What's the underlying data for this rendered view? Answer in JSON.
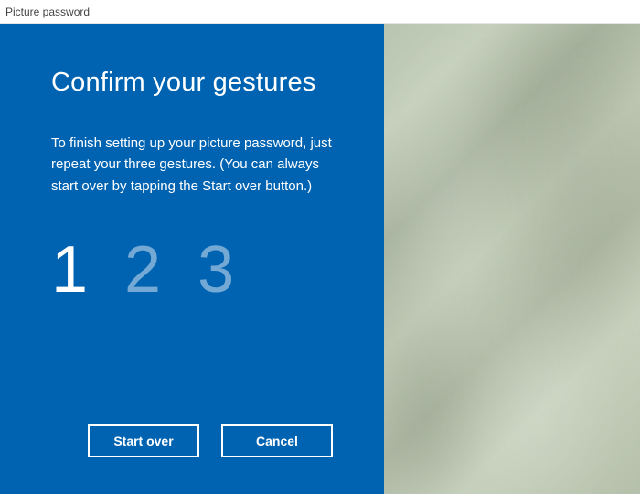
{
  "window": {
    "title": "Picture password"
  },
  "panel": {
    "heading": "Confirm your gestures",
    "instruction": "To finish setting up your picture password, just repeat your three gestures. (You can always start over by tapping the Start over button.)",
    "steps": {
      "s1": "1",
      "s2": "2",
      "s3": "3"
    },
    "buttons": {
      "start_over": "Start over",
      "cancel": "Cancel"
    }
  },
  "colors": {
    "panel_bg": "#0063b1",
    "text_primary": "#ffffff",
    "pending": "rgba(255,255,255,0.45)"
  }
}
